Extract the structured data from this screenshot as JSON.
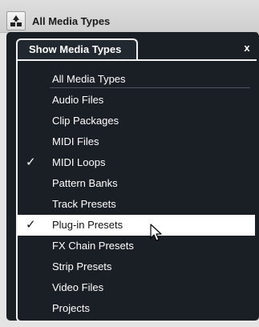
{
  "toolbar": {
    "filter_icon": "filter-funnel-icon",
    "current_value": "All Media Types"
  },
  "panel": {
    "title": "Show Media Types",
    "close_label": "x"
  },
  "menu": {
    "items": [
      {
        "label": "All Media Types",
        "checked": false,
        "highlighted": false
      },
      {
        "label": "Audio Files",
        "checked": false,
        "highlighted": false
      },
      {
        "label": "Clip Packages",
        "checked": false,
        "highlighted": false
      },
      {
        "label": "MIDI Files",
        "checked": false,
        "highlighted": false
      },
      {
        "label": "MIDI Loops",
        "checked": true,
        "highlighted": false
      },
      {
        "label": "Pattern Banks",
        "checked": false,
        "highlighted": false
      },
      {
        "label": "Track Presets",
        "checked": false,
        "highlighted": false
      },
      {
        "label": "Plug-in Presets",
        "checked": true,
        "highlighted": true
      },
      {
        "label": "FX Chain Presets",
        "checked": false,
        "highlighted": false
      },
      {
        "label": "Strip Presets",
        "checked": false,
        "highlighted": false
      },
      {
        "label": "Video Files",
        "checked": false,
        "highlighted": false
      },
      {
        "label": "Projects",
        "checked": false,
        "highlighted": false
      }
    ],
    "check_glyph": "✓"
  },
  "colors": {
    "panel_background": "#1a1f26",
    "highlight_background": "#ffffff",
    "menu_text": "#ffffff"
  }
}
